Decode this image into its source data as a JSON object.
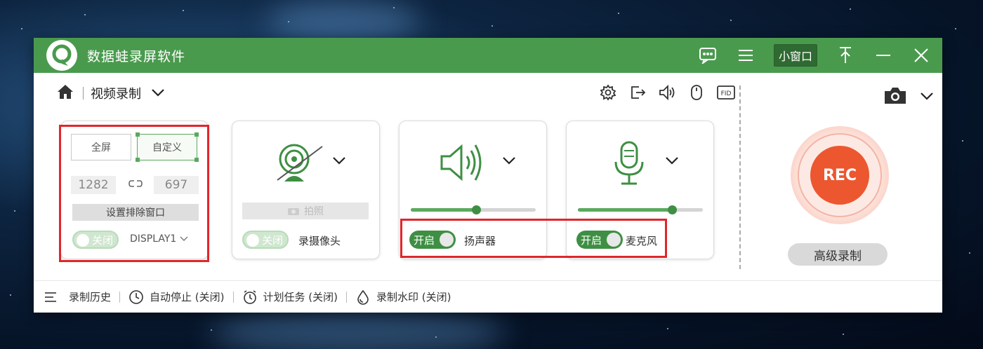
{
  "app": {
    "title": "数据蛙录屏软件"
  },
  "titlebar": {
    "mini_window_label": "小窗口"
  },
  "subbar": {
    "mode_label": "视频录制"
  },
  "region": {
    "fullscreen_label": "全屏",
    "custom_label": "自定义",
    "width": "1282",
    "height": "697",
    "exclude_window_label": "设置排除窗口",
    "toggle_label": "关闭",
    "display_label": "DISPLAY1"
  },
  "webcam": {
    "photo_label": "拍照",
    "toggle_label": "关闭",
    "label": "录摄像头"
  },
  "speaker": {
    "toggle_label": "开启",
    "label": "扬声器",
    "volume_percent": 52
  },
  "microphone": {
    "toggle_label": "开启",
    "label": "麦克风",
    "volume_percent": 75
  },
  "record": {
    "rec_label": "REC",
    "advanced_label": "高级录制"
  },
  "bottom": {
    "history_label": "录制历史",
    "auto_stop_label": "自动停止 (关闭)",
    "schedule_label": "计划任务 (关闭)",
    "watermark_label": "录制水印 (关闭)"
  },
  "colors": {
    "brand_green": "#4a9a4e",
    "rec_orange": "#ec5730",
    "highlight_red": "#e0262b"
  }
}
